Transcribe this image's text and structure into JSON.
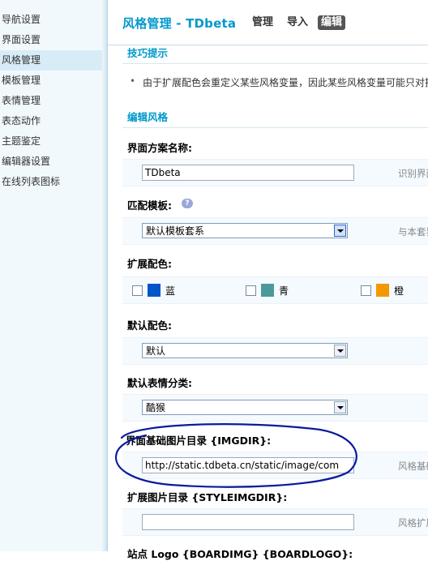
{
  "sidebar": {
    "items": [
      {
        "label": "导航设置"
      },
      {
        "label": "界面设置"
      },
      {
        "label": "风格管理"
      },
      {
        "label": "模板管理"
      },
      {
        "label": "表情管理"
      },
      {
        "label": "表态动作"
      },
      {
        "label": "主题鉴定"
      },
      {
        "label": "编辑器设置"
      },
      {
        "label": "在线列表图标"
      }
    ],
    "active_index": 2
  },
  "header": {
    "title": "风格管理 - TDbeta",
    "tabs": [
      {
        "label": "管理"
      },
      {
        "label": "导入"
      },
      {
        "label": "编辑"
      }
    ],
    "active_tab": "编辑"
  },
  "tips": {
    "heading": "技巧提示",
    "text": "由于扩展配色会重定义某些风格变量，因此某些风格变量可能只对扩"
  },
  "edit": {
    "heading": "编辑风格",
    "scheme_name": {
      "label": "界面方案名称:",
      "value": "TDbeta",
      "hint": "识别界面风"
    },
    "template": {
      "label": "匹配模板:",
      "help_icon": "?",
      "value": "默认模板套系",
      "hint": "与本套界面"
    },
    "ext_colors": {
      "label": "扩展配色:",
      "options": [
        {
          "name": "蓝",
          "color": "#0055c8"
        },
        {
          "name": "青",
          "color": "#4a9a9a"
        },
        {
          "name": "橙",
          "color": "#f39800"
        }
      ]
    },
    "default_color": {
      "label": "默认配色:",
      "value": "默认"
    },
    "smiley_category": {
      "label": "默认表情分类:",
      "value": "酷猴"
    },
    "imgdir": {
      "label": "界面基础图片目录 {IMGDIR}:",
      "value": "http://static.tdbeta.cn/static/image/com",
      "hint": "风格基础图"
    },
    "styleimgdir": {
      "label": "扩展图片目录 {STYLEIMGDIR}:",
      "value": "",
      "hint": "风格扩展图"
    },
    "logo": {
      "label": "站点 Logo {BOARDIMG} {BOARDLOGO}:"
    }
  },
  "colors": {
    "accent": "#0099cc",
    "annotation": "#0a1a9c"
  }
}
